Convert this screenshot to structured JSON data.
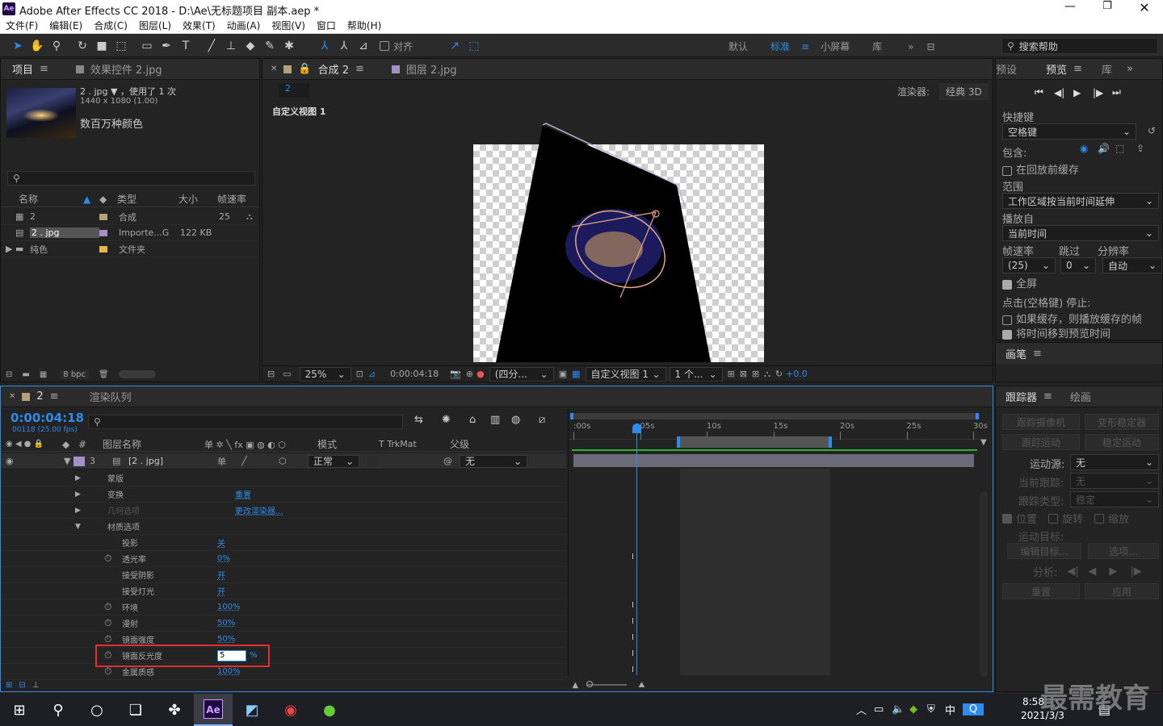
{
  "window": {
    "title": "Adobe After Effects CC 2018 - D:\\Ae\\无标题项目 副本.aep *",
    "app_icon": "Ae"
  },
  "menu": [
    "文件(F)",
    "编辑(E)",
    "合成(C)",
    "图层(L)",
    "效果(T)",
    "动画(A)",
    "视图(V)",
    "窗口",
    "帮助(H)"
  ],
  "toolbar": {
    "snap_label": "对齐",
    "workspaces": [
      "默认",
      "标准",
      "小屏幕",
      "库"
    ],
    "active_workspace": "标准",
    "search_placeholder": "搜索帮助"
  },
  "project": {
    "tabs": [
      "项目",
      "效果控件 2.jpg"
    ],
    "selected_name": "2 . jpg",
    "usage": "，使用了 1 次",
    "dimensions": "1440 x 1080 (1.00)",
    "color_info": "数百万种颜色",
    "columns": [
      "名称",
      "类型",
      "大小",
      "帧速率"
    ],
    "items": [
      {
        "name": "2",
        "type": "合成",
        "size": "",
        "fps": "25"
      },
      {
        "name": "2 . jpg",
        "type": "Importe...G",
        "size": "122 KB",
        "fps": ""
      },
      {
        "name": "纯色",
        "type": "文件夹",
        "size": "",
        "fps": ""
      }
    ],
    "bpc": "8 bpc"
  },
  "composition": {
    "tabs": [
      "合成 2",
      "图层 2.jpg"
    ],
    "breadcrumb": "2",
    "renderer_label": "渲染器:",
    "renderer_value": "经典 3D",
    "view_label": "自定义视图 1",
    "zoom": "25%",
    "timecode": "0:00:04:18",
    "resolution": "(四分...",
    "view_select": "自定义视图 1",
    "views": "1 个...",
    "exposure": "+0.0"
  },
  "preview": {
    "tabs": [
      "预设",
      "预览",
      "库"
    ],
    "shortcut_label": "快捷键",
    "shortcut_value": "空格键",
    "include_label": "包含:",
    "cache_before": "在回放前缓存",
    "range_label": "范围",
    "range_value": "工作区域按当前时间延伸",
    "play_from_label": "播放自",
    "play_from_value": "当前时间",
    "fps_label": "帧速率",
    "skip_label": "跳过",
    "res_label": "分辨率",
    "fps_value": "(25)",
    "skip_value": "0",
    "res_value": "自动",
    "fullscreen": "全屏",
    "stop_label": "点击(空格键) 停止:",
    "stop_opt1": "如果缓存，则播放缓存的帧",
    "stop_opt2": "将时间移到预览时间",
    "brush_tab": "画笔"
  },
  "tracker": {
    "tabs": [
      "跟踪器",
      "绘画"
    ],
    "btn_track_camera": "跟踪摄像机",
    "btn_warp": "变形稳定器",
    "btn_track_motion": "跟踪运动",
    "btn_stabilize": "稳定运动",
    "motion_source_label": "运动源:",
    "motion_source_value": "无",
    "current_track_label": "当前跟踪:",
    "current_track_value": "无",
    "track_type_label": "跟踪类型:",
    "track_type_value": "稳定",
    "pos": "位置",
    "rot": "旋转",
    "scale": "缩放",
    "target_label": "运动目标:",
    "edit_target": "编辑目标...",
    "options": "选项...",
    "analyze_label": "分析:",
    "reset": "重置",
    "apply": "应用"
  },
  "timeline": {
    "tabs": [
      "2",
      "渲染队列"
    ],
    "current_time": "0:00:04:18",
    "frame_info": "00118 (25.00 fps)",
    "col_name": "图层名称",
    "col_mode": "模式",
    "col_trkmat": "T  TrkMat",
    "col_parent": "父级",
    "ruler": [
      ":00s",
      "05s",
      "10s",
      "15s",
      "20s",
      "25s",
      "30s"
    ],
    "layer": {
      "num": "3",
      "name": "[2 . jpg]",
      "mode": "正常",
      "parent": "无"
    },
    "props": [
      {
        "name": "蒙版",
        "value": "",
        "indent": 1,
        "arrow": "▶",
        "stopwatch": false
      },
      {
        "name": "变换",
        "value": "重置",
        "indent": 1,
        "arrow": "▶",
        "stopwatch": false
      },
      {
        "name": "几何选项",
        "value": "更改渲染器...",
        "indent": 1,
        "arrow": "▶",
        "stopwatch": false
      },
      {
        "name": "材质选项",
        "value": "",
        "indent": 1,
        "arrow": "▼",
        "stopwatch": false
      },
      {
        "name": "投影",
        "value": "关",
        "indent": 2,
        "arrow": "",
        "stopwatch": false
      },
      {
        "name": "透光率",
        "value": "0%",
        "indent": 2,
        "arrow": "",
        "stopwatch": true
      },
      {
        "name": "接受阴影",
        "value": "开",
        "indent": 2,
        "arrow": "",
        "stopwatch": false
      },
      {
        "name": "接受灯光",
        "value": "开",
        "indent": 2,
        "arrow": "",
        "stopwatch": false
      },
      {
        "name": "环境",
        "value": "100%",
        "indent": 2,
        "arrow": "",
        "stopwatch": true
      },
      {
        "name": "漫射",
        "value": "50%",
        "indent": 2,
        "arrow": "",
        "stopwatch": true
      },
      {
        "name": "镜面强度",
        "value": "50%",
        "indent": 2,
        "arrow": "",
        "stopwatch": true
      },
      {
        "name": "镜面反光度",
        "value": "5",
        "indent": 2,
        "arrow": "",
        "stopwatch": true,
        "editing": true
      },
      {
        "name": "金属质感",
        "value": "100%",
        "indent": 2,
        "arrow": "",
        "stopwatch": true
      }
    ],
    "editing_suffix": "%"
  },
  "taskbar": {
    "time": "8:58",
    "date": "2021/3/3",
    "ime": "中",
    "watermark": "最需教育"
  },
  "colors": {
    "accent": "#2d8ceb",
    "highlight": "#e03030",
    "panel": "#232323"
  }
}
